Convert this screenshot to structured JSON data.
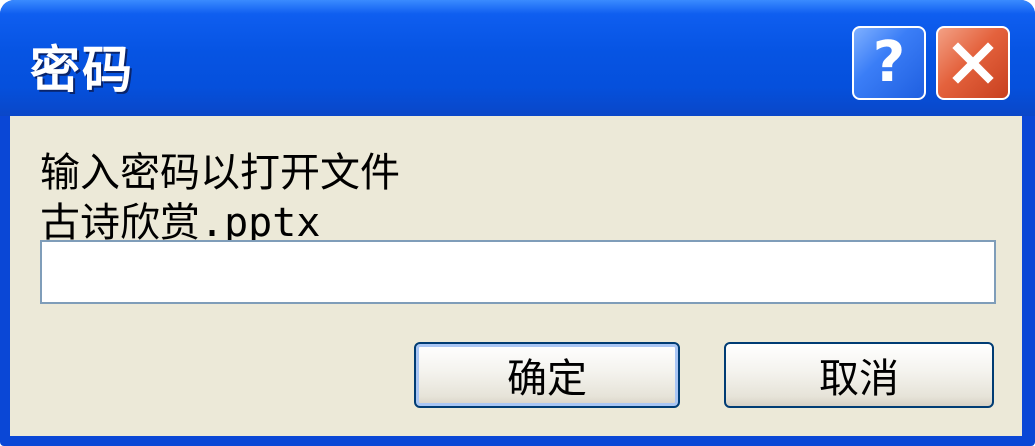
{
  "window": {
    "title": "密码",
    "help_glyph": "?"
  },
  "body": {
    "prompt_line1": "输入密码以打开文件",
    "prompt_line2": "古诗欣赏.pptx",
    "password_value": ""
  },
  "buttons": {
    "ok_label": "确定",
    "cancel_label": "取消"
  },
  "colors": {
    "titlebar": "#0654e3",
    "client": "#ece9d8",
    "close_button": "#e4623d",
    "help_button": "#3b7ef7"
  },
  "icons": {
    "help": "help-question-icon",
    "close": "close-x-icon"
  }
}
